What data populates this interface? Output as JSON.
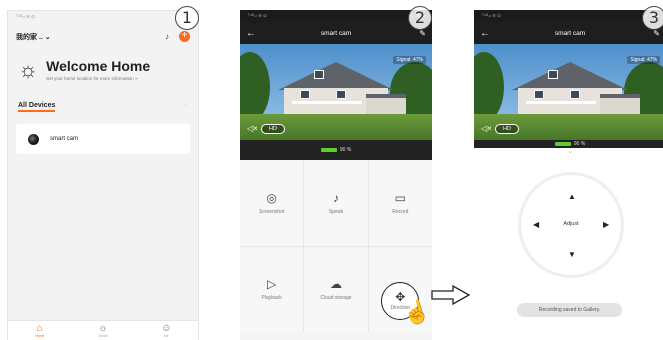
{
  "steps": [
    "1",
    "2",
    "3"
  ],
  "panel1": {
    "status_left": "ᵀ⁴ᴳ.ₗₗ ≋ ⊙",
    "status_right": "◎ 85 ▭",
    "home_name": "我的家 .. ⌄",
    "welcome_title": "Welcome Home",
    "welcome_sub": "Set your home location for more information >",
    "all_devices": "All Devices",
    "more": "···",
    "device_name": "smart cam",
    "tabs": [
      {
        "icon": "⌂",
        "label": "Home"
      },
      {
        "icon": "☼",
        "label": "Smart"
      },
      {
        "icon": "☺",
        "label": "Me"
      }
    ]
  },
  "camera": {
    "title": "smart cam",
    "signal": "Signal: 47%",
    "hd": "HD",
    "battery": "90 %",
    "battery_level": 0.9,
    "status_left": "ᵀ⁴ᴳ.ₗₗ ≋ ⊙",
    "status_right": "◎ 85 ▭"
  },
  "controls": [
    {
      "icon": "◎",
      "label": "Screenshot"
    },
    {
      "icon": "♪",
      "label": "Speak"
    },
    {
      "icon": "▭",
      "label": "Record"
    },
    {
      "icon": "▷",
      "label": "Playback"
    },
    {
      "icon": "☁",
      "label": "Cloud storage"
    },
    {
      "icon": "✥",
      "label": "Direction"
    }
  ],
  "panel3": {
    "adjust_label": "Adjust",
    "toast": "Recording saved to Gallery."
  },
  "colors": {
    "accent": "#ff6a1a",
    "battery": "#5ccf2a",
    "topbar": "#1e1e1e"
  },
  "icons": {
    "tap": "hand-pointer-icon",
    "flow": "right-arrow-icon"
  }
}
